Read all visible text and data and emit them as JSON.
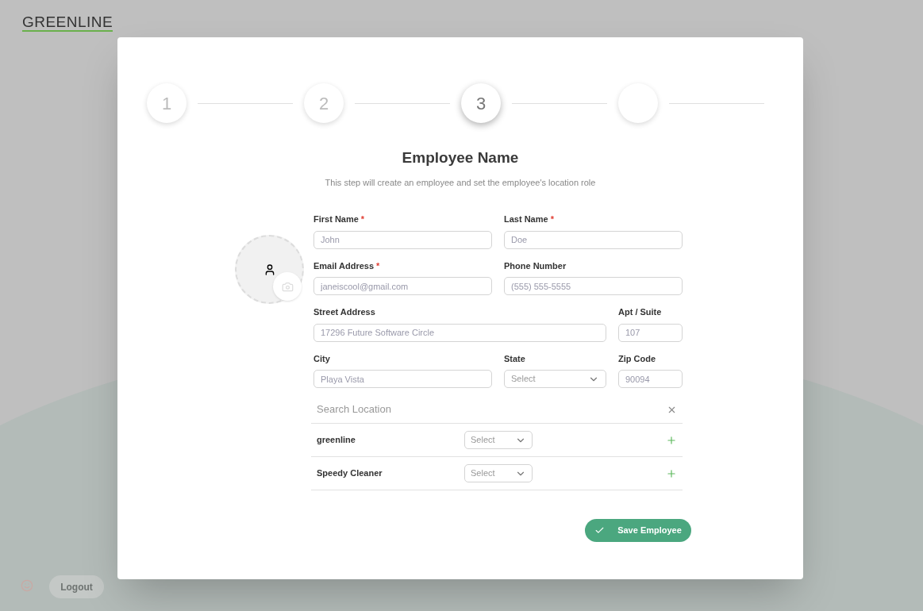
{
  "brand": {
    "logo": "GREENLINE"
  },
  "steps": [
    {
      "label": "1",
      "current": false
    },
    {
      "label": "2",
      "current": false
    },
    {
      "label": "3",
      "current": true
    },
    {
      "current": false
    }
  ],
  "form": {
    "title": "Employee Name",
    "subtitle": "This step will create an employee and set the employee's location role",
    "required_mark": "*",
    "fields": [
      {
        "label": "First Name",
        "required": true,
        "kind": "text",
        "placeholder": "John"
      },
      {
        "label": "Last Name",
        "required": true,
        "kind": "text",
        "placeholder": "Doe"
      },
      {
        "label": "Email Address",
        "required": true,
        "kind": "text",
        "placeholder": "janeiscool@gmail.com"
      },
      {
        "label": "Phone Number",
        "required": false,
        "kind": "text",
        "placeholder": "(555) 555-5555"
      },
      {
        "label": "Street Address",
        "required": false,
        "kind": "text",
        "placeholder": "17296 Future Software Circle"
      },
      {
        "label": "Apt / Suite",
        "required": false,
        "kind": "text",
        "placeholder": "107"
      },
      {
        "label": "City",
        "required": false,
        "kind": "text",
        "placeholder": "Playa Vista"
      },
      {
        "label": "State",
        "required": false,
        "kind": "select",
        "placeholder": "Select"
      },
      {
        "label": "Zip Code",
        "required": false,
        "kind": "text",
        "placeholder": "90094"
      }
    ],
    "location_search": {
      "placeholder": "Search Location"
    },
    "locations": [
      {
        "name": "greenline",
        "role_placeholder": "Select"
      },
      {
        "name": "Speedy Cleaner",
        "role_placeholder": "Select"
      }
    ],
    "save_button": "Save Employee"
  },
  "footer": {
    "logout": "Logout"
  }
}
